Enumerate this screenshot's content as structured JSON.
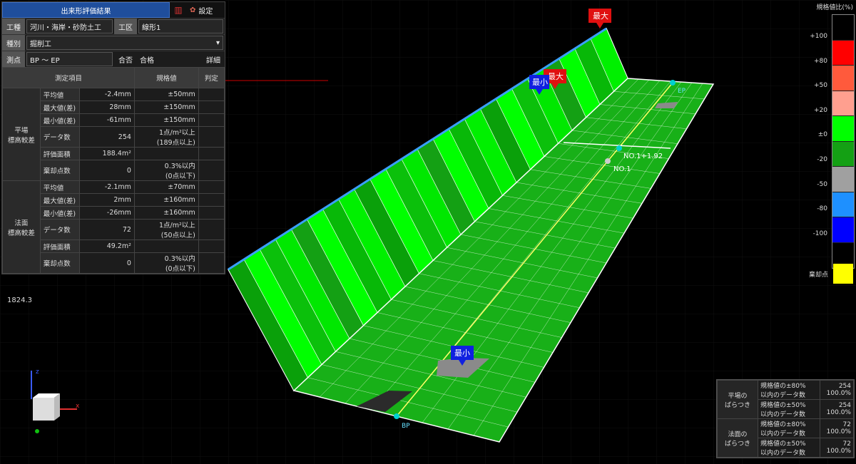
{
  "tabs": {
    "result": "出来形評価結果",
    "settings": "設定"
  },
  "fields": {
    "koushu_label": "工種",
    "koushu_value": "河川・海岸・砂防土工",
    "kouku_label": "工区",
    "kouku_value": "線形1",
    "shubetsu_label": "種別",
    "shubetsu_value": "掘削工",
    "sokuten_label": "測点",
    "sokuten_value": "BP 〜 EP",
    "gouhi_label": "合否",
    "gouhi_value": "合格",
    "detail_label": "詳細"
  },
  "table": {
    "head_item": "測定項目",
    "head_spec": "規格値",
    "head_judge": "判定",
    "groups": [
      {
        "name": "平場\n標高較差",
        "rows": [
          {
            "item": "平均値",
            "value": "-2.4mm",
            "spec": "±50mm"
          },
          {
            "item": "最大値(差)",
            "value": "28mm",
            "spec": "±150mm"
          },
          {
            "item": "最小値(差)",
            "value": "-61mm",
            "spec": "±150mm"
          },
          {
            "item": "データ数",
            "value": "254",
            "spec": "1点/m²以上\n(189点以上)"
          },
          {
            "item": "評価面積",
            "value": "188.4m²",
            "spec": ""
          },
          {
            "item": "棄却点数",
            "value": "0",
            "spec": "0.3%以内\n(0点以下)"
          }
        ]
      },
      {
        "name": "法面\n標高較差",
        "rows": [
          {
            "item": "平均値",
            "value": "-2.1mm",
            "spec": "±70mm"
          },
          {
            "item": "最大値(差)",
            "value": "2mm",
            "spec": "±160mm"
          },
          {
            "item": "最小値(差)",
            "value": "-26mm",
            "spec": "±160mm"
          },
          {
            "item": "データ数",
            "value": "72",
            "spec": "1点/m²以上\n(50点以上)"
          },
          {
            "item": "評価面積",
            "value": "49.2m²",
            "spec": ""
          },
          {
            "item": "棄却点数",
            "value": "0",
            "spec": "0.3%以内\n(0点以下)"
          }
        ]
      }
    ]
  },
  "legend": {
    "title": "規格値比(%)",
    "ticks": [
      "+100",
      "+80",
      "+50",
      "+20",
      "±0",
      "-20",
      "-50",
      "-80",
      "-100"
    ],
    "colors": [
      "#000000",
      "#ff0000",
      "#ff5a3c",
      "#ff9f8f",
      "#00ff00",
      "#14a014",
      "#a0a0a0",
      "#1e90ff",
      "#0000ff",
      "#000000"
    ],
    "reject_label": "棄却点",
    "reject_color": "#ffff00"
  },
  "stats": [
    {
      "group": "平場の\nばらつき",
      "label": "規格値の±80%\n以内のデータ数",
      "count": "254",
      "pct": "100.0%"
    },
    {
      "group": "",
      "label": "規格値の±50%\n以内のデータ数",
      "count": "254",
      "pct": "100.0%"
    },
    {
      "group": "法面の\nばらつき",
      "label": "規格値の±80%\n以内のデータ数",
      "count": "72",
      "pct": "100.0%"
    },
    {
      "group": "",
      "label": "規格値の±50%\n以内のデータ数",
      "count": "72",
      "pct": "100.0%"
    }
  ],
  "scene_labels": {
    "max1": "最大",
    "max2": "最大",
    "min1": "最小",
    "min2": "最小",
    "ep": "EP",
    "bp": "BP",
    "no1_192": "NO.1+1.92",
    "no1": "NO.1",
    "coord": "1824.3"
  }
}
